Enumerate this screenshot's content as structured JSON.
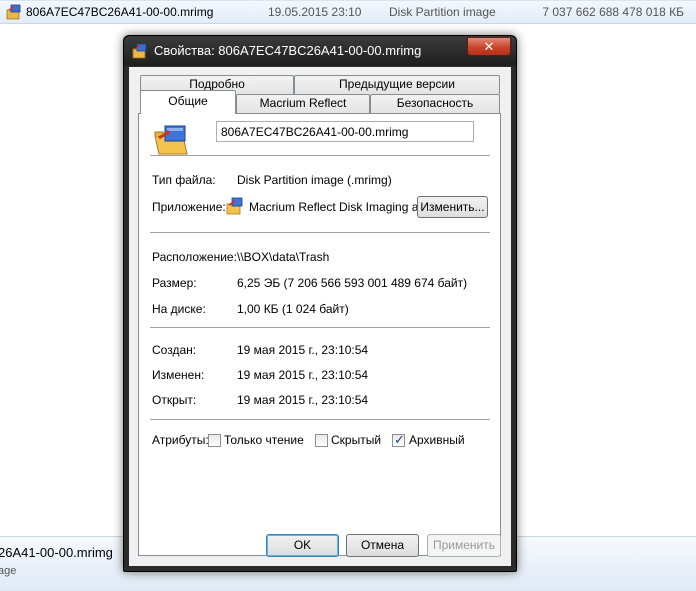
{
  "explorer": {
    "file_row": {
      "name": "806A7EC47BC26A41-00-00.mrimg",
      "date": "19.05.2015 23:10",
      "type": "Disk Partition image",
      "size": "7 037 662 688 478 018 КБ"
    },
    "details_pane": {
      "name": "26A41-00-00.mrimg",
      "type": "age"
    }
  },
  "dialog": {
    "title": "Свойства: 806A7EC47BC26A41-00-00.mrimg",
    "close_glyph": "✕",
    "tabs_row1": [
      {
        "label": "Подробно"
      },
      {
        "label": "Предыдущие версии"
      }
    ],
    "tabs_row2": [
      {
        "label": "Общие",
        "active": true
      },
      {
        "label": "Macrium Reflect"
      },
      {
        "label": "Безопасность"
      }
    ],
    "general": {
      "file_name": "806A7EC47BC26A41-00-00.mrimg",
      "file_type_label": "Тип файла:",
      "file_type_value": "Disk Partition image (.mrimg)",
      "app_label": "Приложение:",
      "app_value": "Macrium Reflect Disk Imaging and",
      "change_button": "Изменить...",
      "location_label": "Расположение:",
      "location_value": "\\\\BOX\\data\\Trash",
      "size_label": "Размер:",
      "size_value": "6,25 ЭБ (7 206 566 593 001 489 674 байт)",
      "ondisk_label": "На диске:",
      "ondisk_value": "1,00 КБ (1 024 байт)",
      "created_label": "Создан:",
      "created_value": "19 мая 2015 г., 23:10:54",
      "modified_label": "Изменен:",
      "modified_value": "19 мая 2015 г., 23:10:54",
      "opened_label": "Открыт:",
      "opened_value": "19 мая 2015 г., 23:10:54",
      "attributes_label": "Атрибуты:",
      "attributes": [
        {
          "label": "Только чтение",
          "checked": false
        },
        {
          "label": "Скрытый",
          "checked": false
        },
        {
          "label": "Архивный",
          "checked": true
        }
      ]
    },
    "buttons": {
      "ok": "OK",
      "cancel": "Отмена",
      "apply": "Применить"
    }
  },
  "icons": {
    "file_icon": "mrimg-file-icon",
    "app_icon": "macrium-app-icon",
    "checkmark": "✓"
  }
}
